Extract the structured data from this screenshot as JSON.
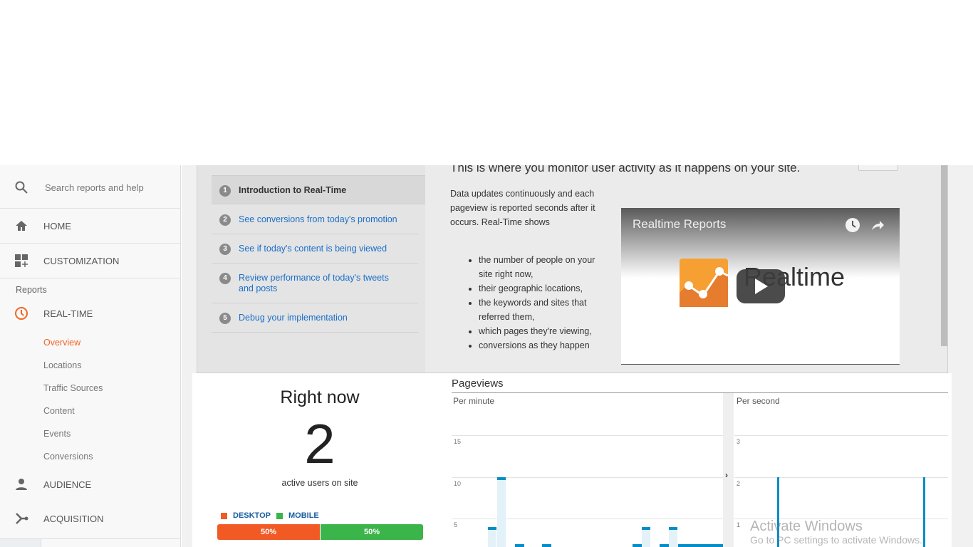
{
  "sidebar": {
    "search_placeholder": "Search reports and help",
    "home": "HOME",
    "customization": "CUSTOMIZATION",
    "reports_heading": "Reports",
    "realtime": "REAL-TIME",
    "realtime_items": [
      "Overview",
      "Locations",
      "Traffic Sources",
      "Content",
      "Events",
      "Conversions"
    ],
    "audience": "AUDIENCE",
    "acquisition": "ACQUISITION",
    "active_color": "#f26522"
  },
  "intro": {
    "headline": "This is where you monitor user activity as it happens on your site.",
    "steps": [
      {
        "num": "1",
        "label": "Introduction to Real-Time"
      },
      {
        "num": "2",
        "label": "See conversions from today's promotion"
      },
      {
        "num": "3",
        "label": "See if today's content is being viewed"
      },
      {
        "num": "4",
        "label": "Review performance of today's tweets and posts"
      },
      {
        "num": "5",
        "label": "Debug your implementation"
      }
    ],
    "paragraph": "Data updates continuously and each pageview is reported seconds after it occurs. Real-Time shows",
    "bullets": [
      "the number of people on your site right now,",
      "their geographic locations,",
      "the keywords and sites that referred them,",
      "which pages they're viewing,",
      "conversions as they happen"
    ],
    "video": {
      "title": "Realtime Reports",
      "logo_text": "Realtime"
    }
  },
  "rightnow": {
    "title": "Right now",
    "count": "2",
    "caption": "active users on site",
    "legend": [
      {
        "label": "DESKTOP",
        "color": "#f15a24"
      },
      {
        "label": "MOBILE",
        "color": "#3bb44a"
      }
    ],
    "desktop_pct": "50%",
    "mobile_pct": "50%"
  },
  "pageviews": {
    "title": "Pageviews",
    "per_minute_label": "Per minute",
    "per_second_label": "Per second"
  },
  "chart_data": [
    {
      "type": "bar",
      "title": "Per minute",
      "yticks": [
        5,
        10,
        15
      ],
      "ylim": [
        0,
        18
      ],
      "values": [
        0,
        0,
        0,
        0,
        4,
        10,
        0,
        2,
        0,
        0,
        2,
        0,
        0,
        0,
        0,
        0,
        0,
        0,
        0,
        0,
        2,
        4,
        0,
        2,
        4,
        2,
        2,
        2,
        2,
        2
      ],
      "color": "#058dc7"
    },
    {
      "type": "bar",
      "title": "Per second",
      "yticks": [
        1,
        2,
        3
      ],
      "ylim": [
        0,
        3.6
      ],
      "values": [
        0,
        0,
        0,
        0,
        0,
        0,
        0,
        0,
        0,
        0,
        0,
        0,
        2,
        0,
        0,
        0,
        0,
        0,
        0,
        0,
        0,
        0,
        0,
        0,
        0,
        0,
        0,
        0,
        0,
        0,
        0,
        0,
        0,
        0,
        0,
        0,
        0,
        0,
        0,
        0,
        0,
        0,
        0,
        0,
        0,
        0,
        0,
        0,
        0,
        0,
        0,
        0,
        0,
        2,
        0,
        0,
        0,
        0,
        0,
        0
      ],
      "color": "#058dc7"
    }
  ],
  "watermark": {
    "line1": "Activate Windows",
    "line2": "Go to PC settings to activate Windows."
  }
}
